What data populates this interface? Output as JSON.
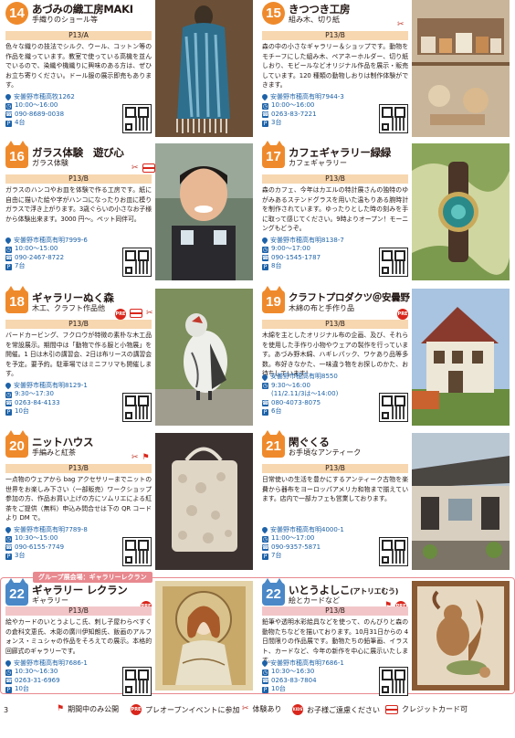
{
  "entries": [
    {
      "num": "14",
      "title": "あづみの織工房MAKI",
      "sub": "手織りのショール等",
      "page": "P13/A",
      "desc": "色々な織りの技法でシルク、ウール、コットン等の作品を織っています。教室で使っている高機を並んでいるので、染織や機織りに興味のある方は、ぜひお立ち寄りください。ドール服の展示即売もあります。",
      "address": "安曇野市穂高牧1262",
      "hours": "10:00～16:00",
      "tel": "090-8689-0038",
      "parking": "4台"
    },
    {
      "num": "15",
      "title": "きつつき工房",
      "sub": "組み木、切り紙",
      "page": "P13/B",
      "desc": "森の中の小さなギャラリー＆ショップです。動物をモチーフにした組み木、ペアネーホルダー、切り紙しおり、モビールなどオリジナル作品を展示・販売しています。120 種類の動物しおりは制作体験ができます。",
      "address": "安曇野市穂高有明7944-3",
      "hours": "10:00～16:00",
      "tel": "0263-83-7221",
      "parking": "3台"
    },
    {
      "num": "16",
      "title": "ガラス体験　遊び心",
      "sub": "ガラス体験",
      "page": "P13/B",
      "desc": "ガラスのハンコやお皿を体験で作る工房です。紙に自由に描いた絵や字がハンコになったりお皿に模りガラスで浮き上がります。3歳ぐらいの小さなお子様から体験出来ます。3000 円〜。ペット同伴可。",
      "address": "安曇野市穂高有明7999-6",
      "hours": "10:00～15:00",
      "tel": "090-2467-8722",
      "parking": "7台"
    },
    {
      "num": "17",
      "title": "カフェギャラリー緑緑",
      "sub": "カフェギャラリー",
      "page": "P13/B",
      "desc": "森のカフェ、今年はカエルの特計展さんの独特のゆがみあるステンドグラスを用いた温もりある腕時計を制作されています。ゆったりとした時の刻みを手に取って感じてください。9時よりオープン！モーニングもどうぞ。",
      "address": "安曇野市穂高有明8138-7",
      "hours": "9:00～17:00",
      "tel": "090-1545-1787",
      "parking": "8台"
    },
    {
      "num": "18",
      "title": "ギャラリーぬく森",
      "sub": "木工、クラフト作品他",
      "page": "P13/B",
      "desc": "バードカービング、フクロウが特徴の素朴な木工品を常設展示。期間中は「動物で作る服と小物展」を開催。1 日は木引の講習会、2日は布リースの講習会を予定。要予約。駐車場ではミニフリマも開催します。",
      "address": "安曇野市穂高有明8129-1",
      "hours": "9:30～17:30",
      "tel": "0263-84-4133",
      "parking": "10台"
    },
    {
      "num": "19",
      "title": "クラフトプロダクツ＠安曇野",
      "sub": "木綿の布と手作り品",
      "page": "P13/B",
      "desc": "木綿を主としたオリジナル布の企画、及び、それらを使用した手作り小物やウェアの製作を行っています。あづみ野木綿、ハギレパック、ワケあり品等多数。布好きなかた、一味違う物をお探しのかた、お待ちしています！",
      "address": "安曇野市穂高有明8550",
      "hours": "9:30～16:00",
      "hours2": "(11/2.11/3は～14:00)",
      "tel": "080-4073-8075",
      "parking": "6台"
    },
    {
      "num": "20",
      "title": "ニットハウス",
      "sub": "手編みと紅茶",
      "page": "P13/B",
      "desc": "一点物のウェアから bag アクセサリーまでニットの世界をお楽しみ下さい（一部販売）ワークショップ参加の方、作品お買い上げの方にソムリエによる紅茶をご提供（無料）申込み問合せは下の QR コードより DM で。",
      "address": "安曇野市穂高有明7789-8",
      "hours": "10:30～15:00",
      "tel": "090-6155-7749",
      "parking": "3台"
    },
    {
      "num": "21",
      "title": "閑ぐくる",
      "sub": "お手頃なアンティーク",
      "page": "P13/B",
      "desc": "日常使いの生活を豊かにするアンティーク古物を楽費から器布をヨーロッパアメリカ和物まで揃えています。店内で一部カフェも営業しております。",
      "address": "安曇野市穂高有明4000-1",
      "hours": "11:00～17:00",
      "tel": "090-9357-5871",
      "parking": "7台"
    },
    {
      "num": "22",
      "title": "ギャラリー レクラン",
      "sub": "ギャラリー",
      "page": "P13/B",
      "desc": "絵やカードのいとうよしこ氏、刺し子屋わらべすくの倉科文恵氏、木彫の廣川伊知朗氏、飯画のアルフォンス・ミュシャの作品をそろえての展示。本格的回廊式のギャラリーです。",
      "address": "安曇野市穂高有明7686-1",
      "hours": "10:30～16:30",
      "tel": "0263-31-6969",
      "parking": "10台"
    },
    {
      "num": "22",
      "title": "いとうよしこ",
      "title_suffix": "(アトリエむう)",
      "sub": "絵とカードなど",
      "page": "P13/B",
      "desc": "鉛筆や透明水彩絵具などを使って、のんびりと森の動物たちなどを描いております。10月31日からの 4日間限りの作品展です。動物たちの鉛筆画、イラスト、カードなど、今年の新作を中心に展示いたします。",
      "address": "安曇野市穂高有明7686-1",
      "hours": "10:30～16:30",
      "tel": "0263-83-7804",
      "parking": "10台"
    }
  ],
  "group_label": "グループ展会場：ギャラリーレクラン",
  "footer": {
    "page_number": "3",
    "legend": [
      "期間中のみ公開",
      "プレオープンイベントに参加",
      "体験あり",
      "お子様ご遠慮ください",
      "クレジットカード可"
    ],
    "pre_text": "PRE",
    "card_text": "CARD",
    "kids_text": "KIDS"
  }
}
